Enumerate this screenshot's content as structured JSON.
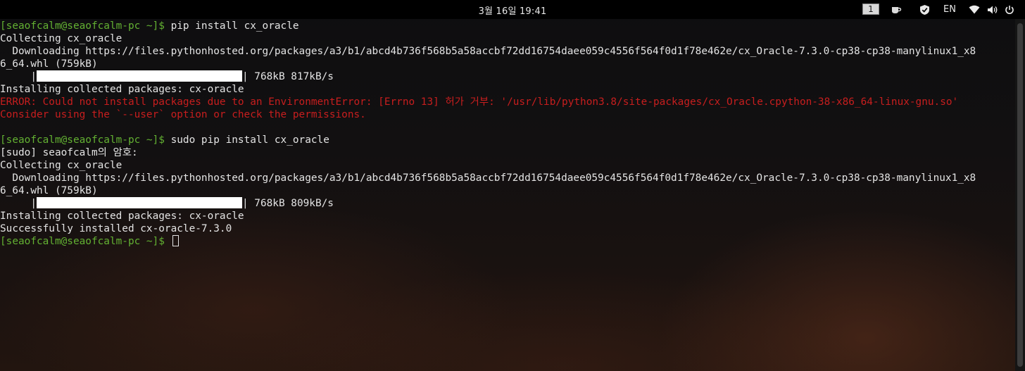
{
  "topbar": {
    "clock": "3월 16일 19:41",
    "workspace": "1",
    "language": "EN"
  },
  "terminal": {
    "lines": [
      {
        "prompt": "[seaofcalm@seaofcalm-pc ~]$",
        "text": " pip install cx_oracle"
      },
      {
        "text": "Collecting cx_oracle"
      },
      {
        "text": "  Downloading https://files.pythonhosted.org/packages/a3/b1/abcd4b736f568b5a58accbf72dd16754daee059c4556f564f0d1f78e462e/cx_Oracle-7.3.0-cp38-cp38-manylinux1_x8"
      },
      {
        "text": "6_64.whl (759kB)"
      },
      {
        "pre": "     |",
        "post": "| 768kB 817kB/s"
      },
      {
        "text": "Installing collected packages: cx-oracle"
      },
      {
        "error": "ERROR: Could not install packages due to an EnvironmentError: [Errno 13] 허가 거부: '/usr/lib/python3.8/site-packages/cx_Oracle.cpython-38-x86_64-linux-gnu.so'"
      },
      {
        "error": "Consider using the `--user` option or check the permissions."
      },
      {
        "text": ""
      },
      {
        "prompt": "[seaofcalm@seaofcalm-pc ~]$",
        "text": " sudo pip install cx_oracle"
      },
      {
        "text": "[sudo] seaofcalm의 암호:"
      },
      {
        "text": "Collecting cx_oracle"
      },
      {
        "text": "  Downloading https://files.pythonhosted.org/packages/a3/b1/abcd4b736f568b5a58accbf72dd16754daee059c4556f564f0d1f78e462e/cx_Oracle-7.3.0-cp38-cp38-manylinux1_x8"
      },
      {
        "text": "6_64.whl (759kB)"
      },
      {
        "pre": "     |",
        "post": "| 768kB 809kB/s"
      },
      {
        "text": "Installing collected packages: cx-oracle"
      },
      {
        "text": "Successfully installed cx-oracle-7.3.0"
      },
      {
        "prompt": "[seaofcalm@seaofcalm-pc ~]$",
        "text": " "
      }
    ]
  },
  "icons": {
    "cup": "cup-icon",
    "shield": "shield-icon",
    "wifi": "wifi-icon",
    "volume": "volume-icon",
    "power": "power-icon"
  },
  "colors": {
    "prompt": "#63b132",
    "error": "#c81e1e",
    "text": "#e4e4e4",
    "panel": "#000000"
  }
}
